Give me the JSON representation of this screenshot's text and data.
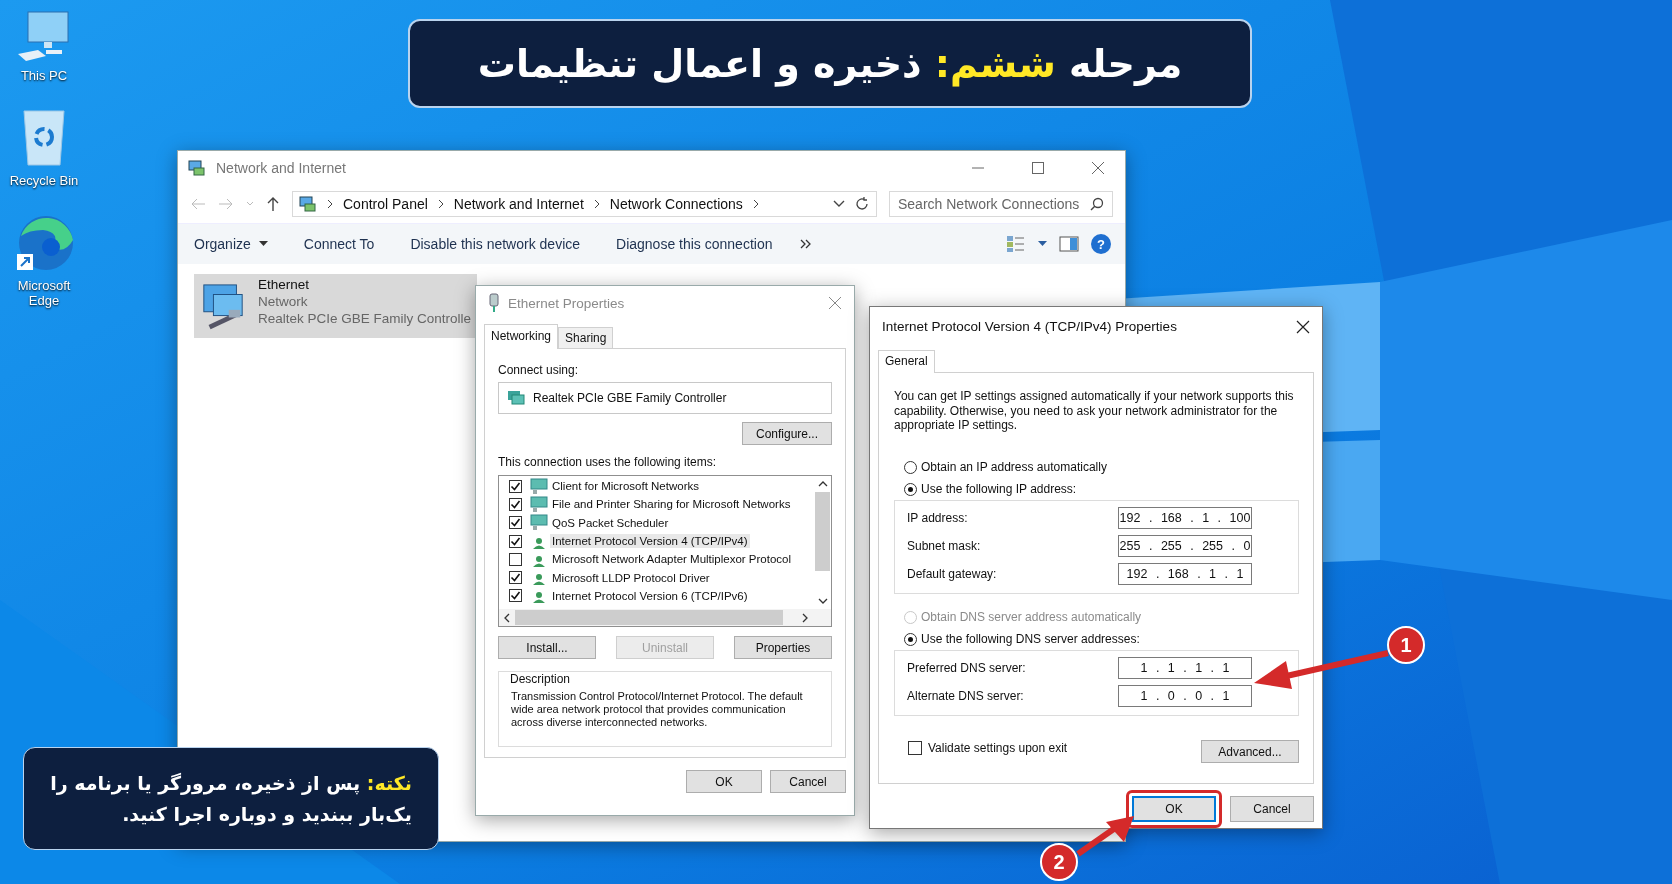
{
  "banner": {
    "title": "مرحله **ششم:** ذخیره و اعمال تنظیمات"
  },
  "desktop_icons": [
    {
      "label": "This PC",
      "kind": "pc"
    },
    {
      "label": "Recycle Bin",
      "kind": "bin"
    },
    {
      "label": "Microsoft Edge",
      "kind": "browser"
    }
  ],
  "explorer": {
    "title": "Network and Internet",
    "breadcrumbs": [
      "Control Panel",
      "Network and Internet",
      "Network Connections"
    ],
    "search": {
      "placeholder": "Search Network Connections"
    },
    "help": "?",
    "toolbar": [
      {
        "label": "Organize",
        "dropdown": true
      },
      {
        "label": "Connect To",
        "dropdown": false
      },
      {
        "label": "Disable this network device",
        "dropdown": false
      },
      {
        "label": "Diagnose this connection",
        "dropdown": false
      }
    ],
    "connection": {
      "name": "Ethernet",
      "status": "Network",
      "adapter": "Realtek PCIe GBE Family Controlle",
      "selected": true
    }
  },
  "ethernet_properties": {
    "title": "Ethernet Properties",
    "tabs": [
      {
        "label": "Networking",
        "selected": true
      },
      {
        "label": "Sharing",
        "selected": false
      }
    ],
    "connect_using_label": "Connect using:",
    "adapter": "Realtek PCIe GBE Family Controller",
    "configure": "Configure...",
    "items_label": "This connection uses the following items:",
    "items": [
      {
        "label": "Client for Microsoft Networks",
        "checked": true,
        "kind": "service",
        "selected": false
      },
      {
        "label": "File and Printer Sharing for Microsoft Networks",
        "checked": true,
        "kind": "service",
        "selected": false
      },
      {
        "label": "QoS Packet Scheduler",
        "checked": true,
        "kind": "service",
        "selected": false
      },
      {
        "label": "Internet Protocol Version 4 (TCP/IPv4)",
        "checked": true,
        "kind": "protocol",
        "selected": true
      },
      {
        "label": "Microsoft Network Adapter Multiplexor Protocol",
        "checked": false,
        "kind": "protocol",
        "selected": false
      },
      {
        "label": "Microsoft LLDP Protocol Driver",
        "checked": true,
        "kind": "protocol",
        "selected": false
      },
      {
        "label": "Internet Protocol Version 6 (TCP/IPv6)",
        "checked": true,
        "kind": "protocol",
        "selected": false
      }
    ],
    "actions": [
      {
        "label": "Install...",
        "disabled": false
      },
      {
        "label": "Uninstall",
        "disabled": true
      },
      {
        "label": "Properties",
        "disabled": false
      }
    ],
    "description_label": "Description",
    "description": "Transmission Control Protocol/Internet Protocol. The default wide area network protocol that provides communication across diverse interconnected networks.",
    "buttons": [
      "OK",
      "Cancel"
    ]
  },
  "ipv4_properties": {
    "title": "Internet Protocol Version 4 (TCP/IPv4) Properties",
    "tabs": [
      {
        "label": "General",
        "selected": true
      }
    ],
    "intro": "You can get IP settings assigned automatically if your network supports this capability. Otherwise, you need to ask your network administrator for the appropriate IP settings.",
    "ip_modes": [
      {
        "label": "Obtain an IP address automatically",
        "selected": false,
        "disabled": false
      },
      {
        "label": "Use the following IP address:",
        "selected": true,
        "disabled": false
      }
    ],
    "ip_fields": [
      {
        "label": "IP address:",
        "value": "192 . 168 . 1 . 100"
      },
      {
        "label": "Subnet mask:",
        "value": "255 . 255 . 255 . 0"
      },
      {
        "label": "Default gateway:",
        "value": "192 . 168 . 1 . 1"
      }
    ],
    "dns_modes": [
      {
        "label": "Obtain DNS server address automatically",
        "selected": false,
        "disabled": true
      },
      {
        "label": "Use the following DNS server addresses:",
        "selected": true,
        "disabled": false
      }
    ],
    "dns_fields": [
      {
        "label": "Preferred DNS server:",
        "value": "1 . 1 . 1 . 1"
      },
      {
        "label": "Alternate DNS server:",
        "value": "1 . 0 . 0 . 1"
      }
    ],
    "validate": {
      "label": "Validate settings upon exit",
      "checked": false
    },
    "advanced": "Advanced...",
    "ok": {
      "label": "OK",
      "highlighted": true
    },
    "cancel": "Cancel"
  },
  "markers": [
    {
      "label": "1"
    },
    {
      "label": "2"
    }
  ],
  "note": {
    "lines": [
      "**نکته:** پس از ذخیره، مرورگر یا برنامه را",
      "یک‌بار ببندید و دوباره اجرا کنید."
    ]
  }
}
